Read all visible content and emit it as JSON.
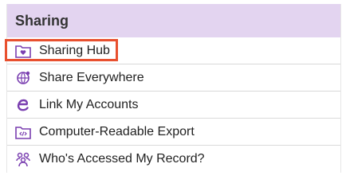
{
  "section": {
    "title": "Sharing"
  },
  "menu": {
    "items": [
      {
        "label": "Sharing Hub",
        "icon": "folder-heart-icon",
        "highlighted": true
      },
      {
        "label": "Share Everywhere",
        "icon": "globe-share-icon"
      },
      {
        "label": "Link My Accounts",
        "icon": "link-e-icon"
      },
      {
        "label": "Computer-Readable Export",
        "icon": "folder-code-icon"
      },
      {
        "label": "Who's Accessed My Record?",
        "icon": "people-icon"
      }
    ]
  },
  "colors": {
    "header_bg": "#e3d4f0",
    "icon_purple": "#7a3fb0",
    "highlight_border": "#e8502f",
    "divider": "#d9d9d9"
  }
}
